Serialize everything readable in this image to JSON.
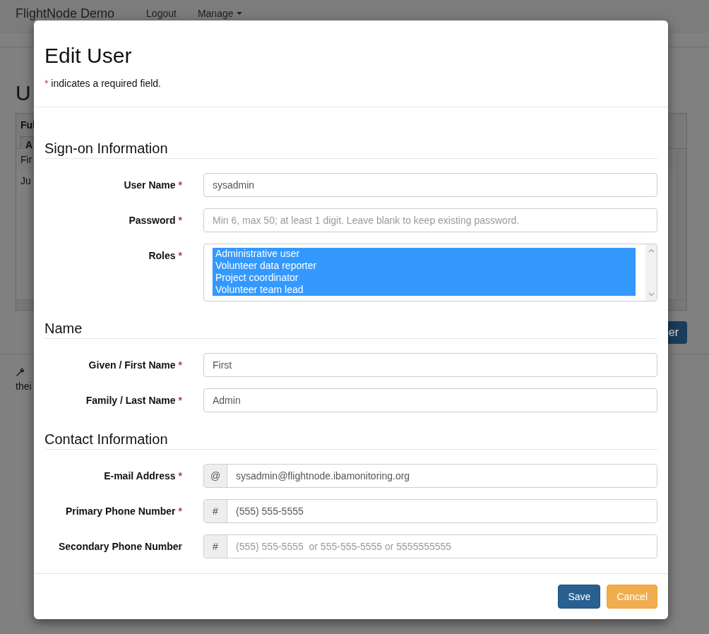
{
  "background": {
    "brand": "FlightNode Demo",
    "nav": [
      {
        "label": "Logout",
        "kind": "link"
      },
      {
        "label": "Manage",
        "kind": "dropdown"
      }
    ],
    "heading": "U",
    "table": {
      "header": "Ful",
      "action": "A",
      "rows": [
        "Fir",
        "Ju"
      ]
    },
    "add_button": "er",
    "footer_lines": [
      "thei"
    ]
  },
  "modal": {
    "title": "Edit User",
    "note_mark": "*",
    "note": "indicates a required field.",
    "sections": [
      {
        "title": "Sign-on Information",
        "fields": [
          {
            "label": "User Name",
            "required_mark": "*",
            "kind": "text",
            "value": "sysadmin"
          },
          {
            "label": "Password",
            "required_mark": "*",
            "kind": "text",
            "placeholder": "Min 6, max 50; at least 1 digit. Leave blank to keep existing password."
          },
          {
            "label": "Roles",
            "required_mark": "*",
            "kind": "listbox",
            "options": [
              {
                "label": "Administrative user",
                "selected": true
              },
              {
                "label": "Volunteer data reporter",
                "selected": true
              },
              {
                "label": "Project coordinator",
                "selected": true
              },
              {
                "label": "Volunteer team lead",
                "selected": true
              }
            ]
          }
        ]
      },
      {
        "title": "Name",
        "fields": [
          {
            "label": "Given / First Name",
            "required_mark": "*",
            "kind": "text",
            "value": "First"
          },
          {
            "label": "Family / Last Name",
            "required_mark": "*",
            "kind": "text",
            "value": "Admin"
          }
        ]
      },
      {
        "title": "Contact Information",
        "fields": [
          {
            "label": "E-mail Address",
            "required_mark": "*",
            "kind": "addon",
            "addon": "@",
            "value": "sysadmin@flightnode.ibamonitoring.org"
          },
          {
            "label": "Primary Phone Number",
            "required_mark": "*",
            "kind": "addon",
            "addon": "#",
            "value": "(555) 555-5555"
          },
          {
            "label": "Secondary Phone Number",
            "kind": "addon",
            "addon": "#",
            "placeholder": "(555) 555-5555  or 555-555-5555 or 5555555555"
          }
        ]
      }
    ],
    "buttons": [
      {
        "label": "Save",
        "kind": "primary"
      },
      {
        "label": "Cancel",
        "kind": "warning"
      }
    ]
  }
}
